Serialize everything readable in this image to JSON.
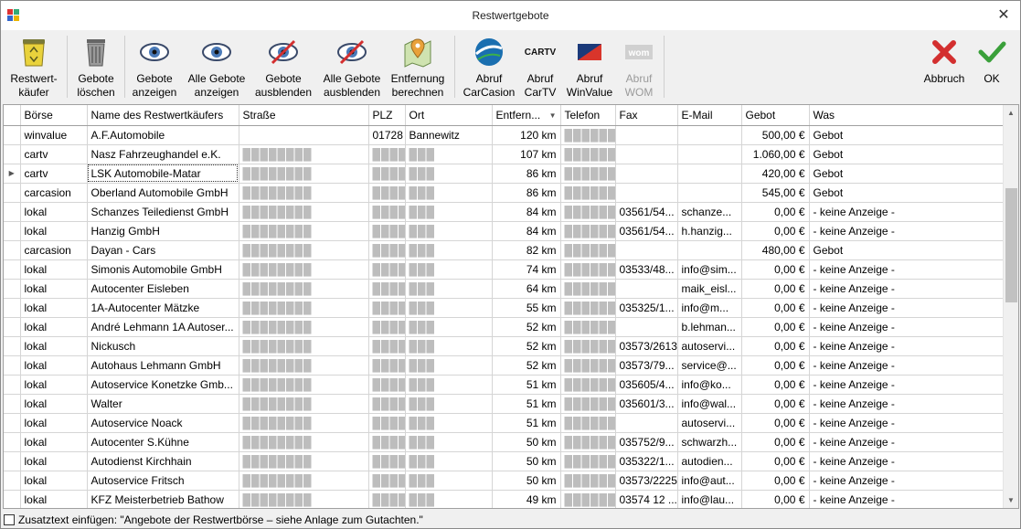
{
  "window": {
    "title": "Restwertgebote"
  },
  "toolbar": {
    "buttons": [
      {
        "line1": "Restwert-",
        "line2": "käufer"
      },
      {
        "line1": "Gebote",
        "line2": "löschen"
      },
      {
        "line1": "Gebote",
        "line2": "anzeigen"
      },
      {
        "line1": "Alle Gebote",
        "line2": "anzeigen"
      },
      {
        "line1": "Gebote",
        "line2": "ausblenden"
      },
      {
        "line1": "Alle Gebote",
        "line2": "ausblenden"
      },
      {
        "line1": "Entfernung",
        "line2": "berechnen"
      },
      {
        "line1": "Abruf",
        "line2": "CarCasion"
      },
      {
        "line1": "Abruf",
        "line2": "CarTV"
      },
      {
        "line1": "Abruf",
        "line2": "WinValue"
      },
      {
        "line1": "Abruf",
        "line2": "WOM"
      },
      {
        "line1": "Abbruch",
        "line2": ""
      },
      {
        "line1": "OK",
        "line2": ""
      }
    ],
    "logos": {
      "cartv": "CARTV",
      "wom": "wom"
    }
  },
  "columns": [
    "Börse",
    "Name des Restwertkäufers",
    "Straße",
    "PLZ",
    "Ort",
    "Entfern...",
    "Telefon",
    "Fax",
    "E-Mail",
    "Gebot",
    "Was"
  ],
  "rows": [
    {
      "boerse": "winvalue",
      "name": "A.F.Automobile",
      "strasse": "",
      "plz": "01728",
      "ort": "Bannewitz",
      "entf": "120 km",
      "tel": "██████",
      "fax": "",
      "email": "",
      "gebot": "500,00 €",
      "was": "Gebot"
    },
    {
      "boerse": "cartv",
      "name": "Nasz Fahrzeughandel e.K.",
      "strasse": "████████",
      "plz": "████",
      "ort": "███",
      "entf": "107 km",
      "tel": "██████",
      "fax": "",
      "email": "",
      "gebot": "1.060,00 €",
      "was": "Gebot"
    },
    {
      "boerse": "cartv",
      "name": "LSK Automobile-Matar",
      "strasse": "████████",
      "plz": "████",
      "ort": "███",
      "entf": "86 km",
      "tel": "██████",
      "fax": "",
      "email": "",
      "gebot": "420,00 €",
      "was": "Gebot"
    },
    {
      "boerse": "carcasion",
      "name": "Oberland Automobile GmbH",
      "strasse": "████████",
      "plz": "████",
      "ort": "███",
      "entf": "86 km",
      "tel": "██████",
      "fax": "",
      "email": "",
      "gebot": "545,00 €",
      "was": "Gebot"
    },
    {
      "boerse": "lokal",
      "name": "Schanzes Teiledienst GmbH",
      "strasse": "████████",
      "plz": "████",
      "ort": "███",
      "entf": "84 km",
      "tel": "██████",
      "fax": "03561/54...",
      "email": "schanze...",
      "gebot": "0,00 €",
      "was": "- keine Anzeige -"
    },
    {
      "boerse": "lokal",
      "name": "Hanzig GmbH",
      "strasse": "████████",
      "plz": "████",
      "ort": "███",
      "entf": "84 km",
      "tel": "██████",
      "fax": "03561/54...",
      "email": "h.hanzig...",
      "gebot": "0,00 €",
      "was": "- keine Anzeige -"
    },
    {
      "boerse": "carcasion",
      "name": "Dayan - Cars",
      "strasse": "████████",
      "plz": "████",
      "ort": "███",
      "entf": "82 km",
      "tel": "██████",
      "fax": "",
      "email": "",
      "gebot": "480,00 €",
      "was": "Gebot"
    },
    {
      "boerse": "lokal",
      "name": "Simonis Automobile GmbH",
      "strasse": "████████",
      "plz": "████",
      "ort": "███",
      "entf": "74 km",
      "tel": "██████",
      "fax": "03533/48...",
      "email": "info@sim...",
      "gebot": "0,00 €",
      "was": "- keine Anzeige -"
    },
    {
      "boerse": "lokal",
      "name": "Autocenter Eisleben",
      "strasse": "████████",
      "plz": "████",
      "ort": "███",
      "entf": "64 km",
      "tel": "██████",
      "fax": "",
      "email": "maik_eisl...",
      "gebot": "0,00 €",
      "was": "- keine Anzeige -"
    },
    {
      "boerse": "lokal",
      "name": "1A-Autocenter Mätzke",
      "strasse": "████████",
      "plz": "████",
      "ort": "███",
      "entf": "55 km",
      "tel": "██████",
      "fax": "035325/1...",
      "email": "info@m...",
      "gebot": "0,00 €",
      "was": "- keine Anzeige -"
    },
    {
      "boerse": "lokal",
      "name": "André Lehmann 1A Autoser...",
      "strasse": "████████",
      "plz": "████",
      "ort": "███",
      "entf": "52 km",
      "tel": "██████",
      "fax": "",
      "email": "b.lehman...",
      "gebot": "0,00 €",
      "was": "- keine Anzeige -"
    },
    {
      "boerse": "lokal",
      "name": "Nickusch",
      "strasse": "████████",
      "plz": "████",
      "ort": "███",
      "entf": "52 km",
      "tel": "██████",
      "fax": "03573/2613",
      "email": "autoservi...",
      "gebot": "0,00 €",
      "was": "- keine Anzeige -"
    },
    {
      "boerse": "lokal",
      "name": "Autohaus Lehmann GmbH",
      "strasse": "████████",
      "plz": "████",
      "ort": "███",
      "entf": "52 km",
      "tel": "██████",
      "fax": "03573/79...",
      "email": "service@...",
      "gebot": "0,00 €",
      "was": "- keine Anzeige -"
    },
    {
      "boerse": "lokal",
      "name": "Autoservice Konetzke Gmb...",
      "strasse": "████████",
      "plz": "████",
      "ort": "███",
      "entf": "51 km",
      "tel": "██████",
      "fax": "035605/4...",
      "email": "info@ko...",
      "gebot": "0,00 €",
      "was": "- keine Anzeige -"
    },
    {
      "boerse": "lokal",
      "name": "Walter",
      "strasse": "████████",
      "plz": "████",
      "ort": "███",
      "entf": "51 km",
      "tel": "██████",
      "fax": "035601/3...",
      "email": "info@wal...",
      "gebot": "0,00 €",
      "was": "- keine Anzeige -"
    },
    {
      "boerse": "lokal",
      "name": "Autoservice Noack",
      "strasse": "████████",
      "plz": "████",
      "ort": "███",
      "entf": "51 km",
      "tel": "██████",
      "fax": "",
      "email": "autoservi...",
      "gebot": "0,00 €",
      "was": "- keine Anzeige -"
    },
    {
      "boerse": "lokal",
      "name": "Autocenter S.Kühne",
      "strasse": "████████",
      "plz": "████",
      "ort": "███",
      "entf": "50 km",
      "tel": "██████",
      "fax": "035752/9...",
      "email": "schwarzh...",
      "gebot": "0,00 €",
      "was": "- keine Anzeige -"
    },
    {
      "boerse": "lokal",
      "name": "Autodienst Kirchhain",
      "strasse": "████████",
      "plz": "████",
      "ort": "███",
      "entf": "50 km",
      "tel": "██████",
      "fax": "035322/1...",
      "email": "autodien...",
      "gebot": "0,00 €",
      "was": "- keine Anzeige -"
    },
    {
      "boerse": "lokal",
      "name": "Autoservice Fritsch",
      "strasse": "████████",
      "plz": "████",
      "ort": "███",
      "entf": "50 km",
      "tel": "██████",
      "fax": "03573/2225",
      "email": "info@aut...",
      "gebot": "0,00 €",
      "was": "- keine Anzeige -"
    },
    {
      "boerse": "lokal",
      "name": "KFZ Meisterbetrieb Bathow",
      "strasse": "████████",
      "plz": "████",
      "ort": "███",
      "entf": "49 km",
      "tel": "██████",
      "fax": "03574 12 ...",
      "email": "info@lau...",
      "gebot": "0,00 €",
      "was": "- keine Anzeige -"
    }
  ],
  "footer": {
    "checkbox_label": "Zusatztext einfügen: \"Angebote der Restwertbörse – siehe Anlage zum Gutachten.\""
  },
  "colors": {
    "accent_red": "#d32f2f",
    "accent_green": "#3aa03a",
    "winvalue_blue": "#1b3a7a",
    "winvalue_red": "#d9352b"
  }
}
